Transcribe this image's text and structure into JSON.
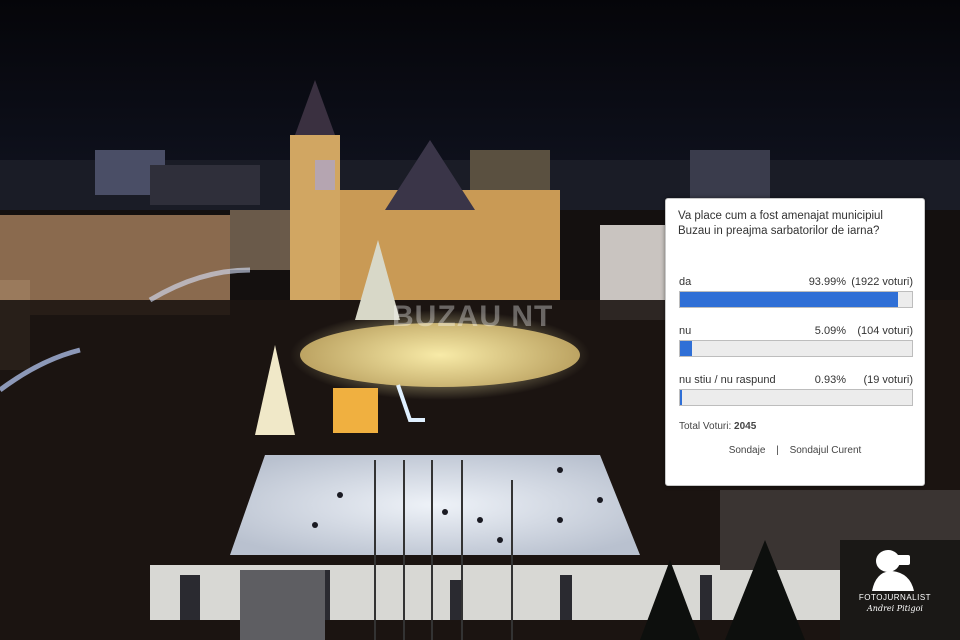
{
  "poll": {
    "question": "Va place cum a fost amenajat municipiul Buzau in preajma sarbatorilor de iarna?",
    "options": [
      {
        "label": "da",
        "percent": "93.99%",
        "votes": "(1922 voturi)",
        "fraction": 0.9399
      },
      {
        "label": "nu",
        "percent": "5.09%",
        "votes": "(104 voturi)",
        "fraction": 0.0509
      },
      {
        "label": "nu stiu / nu raspund",
        "percent": "0.93%",
        "votes": "(19 voturi)",
        "fraction": 0.0093
      }
    ],
    "total_label": "Total Voturi:",
    "total_value": "2045",
    "links": {
      "surveys": "Sondaje",
      "separator": "|",
      "current": "Sondajul Curent"
    },
    "bar_color": "#2f6fd6"
  },
  "photo": {
    "watermark": "BUZAU NT",
    "logo_line1": "FOTOJURNALIST",
    "logo_line2": "Andrei Pitigoi"
  }
}
